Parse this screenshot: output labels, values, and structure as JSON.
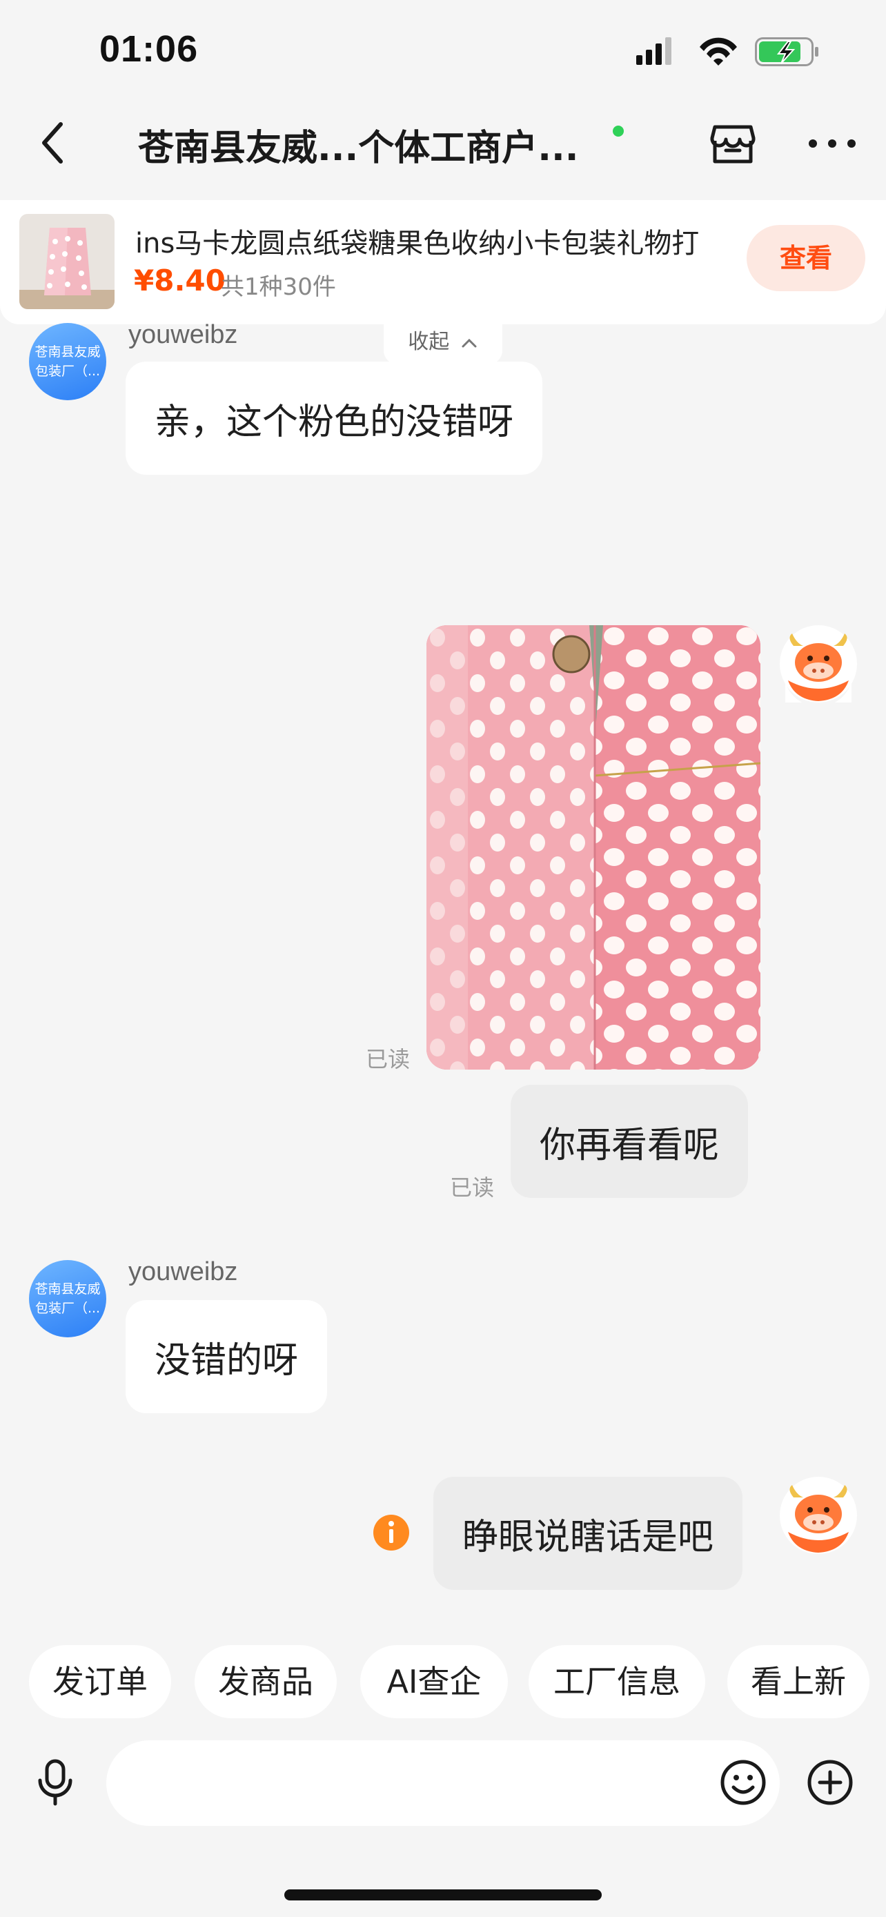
{
  "status_bar": {
    "time": "01:06"
  },
  "nav": {
    "title": "苍南县友威...个体工商户..."
  },
  "product": {
    "title": "ins马卡龙圆点纸袋糖果色收纳小卡包装礼物打",
    "price": "¥8.40",
    "quantity": "共1种30件",
    "view_label": "查看"
  },
  "collapse_label": "收起",
  "messages": {
    "m1": {
      "sender": "youweibz",
      "avatar_line1": "苍南县友威",
      "avatar_line2": "包装厂（...",
      "text": "亲，这个粉色的没错呀"
    },
    "m2": {
      "read": "已读"
    },
    "m3": {
      "text": "你再看看呢",
      "read": "已读"
    },
    "m4": {
      "sender": "youweibz",
      "avatar_line1": "苍南县友威",
      "avatar_line2": "包装厂（...",
      "text": "没错的呀"
    },
    "m5": {
      "text": "睁眼说瞎话是吧"
    }
  },
  "quick_actions": [
    "发订单",
    "发商品",
    "AI查企",
    "工厂信息",
    "看上新"
  ],
  "input": {
    "placeholder": ""
  },
  "colors": {
    "accent": "#ff4d00",
    "online": "#2fd158",
    "seller_avatar": "#2c7ff6",
    "user_avatar": "#ff6b2c"
  }
}
